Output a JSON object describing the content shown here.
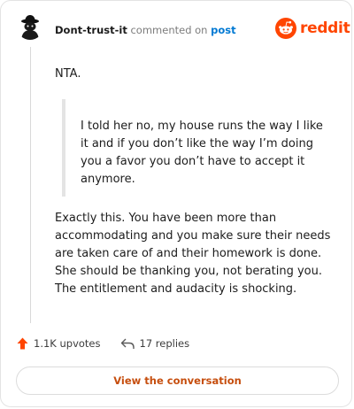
{
  "header": {
    "username": "Dont-trust-it",
    "action_text": "commented on",
    "post_link": "post"
  },
  "brand": {
    "wordmark": "reddit",
    "icon": "reddit-snoo-icon",
    "color": "#ff4500"
  },
  "comment": {
    "intro": "NTA.",
    "quote": "I told her no, my house runs the way I like it and if you don’t like the way I’m doing you a favor you don’t have to accept it anymore.",
    "reply": "Exactly this. You have been more than accommodating and you make sure their needs are taken care of and their homework is done. She should be thanking you, not berating you. The entitlement and audacity is shocking."
  },
  "footer": {
    "upvotes": "1.1K upvotes",
    "upvote_icon": "upvote-arrow-icon",
    "upvote_color": "#ff4500",
    "replies": "17 replies",
    "reply_icon": "reply-arrow-icon"
  },
  "cta": {
    "label": "View the conversation",
    "color": "#c64e0e"
  }
}
